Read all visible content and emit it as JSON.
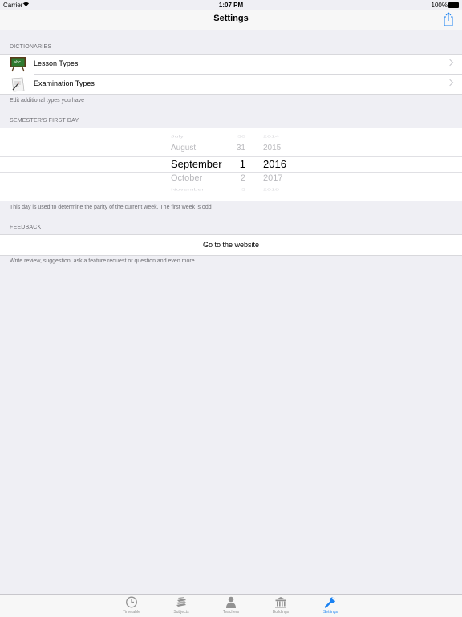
{
  "status_bar": {
    "carrier": "Carrier",
    "time": "1:07 PM",
    "battery": "100%"
  },
  "nav": {
    "title": "Settings"
  },
  "dictionaries": {
    "header": "DICTIONARIES",
    "items": [
      {
        "label": "Lesson Types",
        "icon": "chalkboard-icon"
      },
      {
        "label": "Examination Types",
        "icon": "exam-paper-icon"
      }
    ],
    "footer": "Edit additional types you have"
  },
  "semester": {
    "header": "SEMESTER'S FIRST DAY",
    "picker": {
      "months": [
        "July",
        "August",
        "September",
        "October",
        "November"
      ],
      "days": [
        "30",
        "31",
        "1",
        "2",
        "3"
      ],
      "years": [
        "2014",
        "2015",
        "2016",
        "2017",
        "2018"
      ]
    },
    "footer": "This day is used to determine the parity of the current week. The first week is odd"
  },
  "feedback": {
    "header": "FEEDBACK",
    "button": "Go to the website",
    "footer": "Write review, suggestion, ask a feature request or question and even more"
  },
  "tabs": [
    {
      "label": "Timetable",
      "icon": "clock-icon"
    },
    {
      "label": "Subjects",
      "icon": "books-icon"
    },
    {
      "label": "Teachers",
      "icon": "person-icon"
    },
    {
      "label": "Buildings",
      "icon": "building-icon"
    },
    {
      "label": "Settings",
      "icon": "wrench-icon",
      "active": true
    }
  ],
  "colors": {
    "accent": "#1a82f2",
    "background": "#efeff4",
    "separator": "#d8d8dc"
  }
}
